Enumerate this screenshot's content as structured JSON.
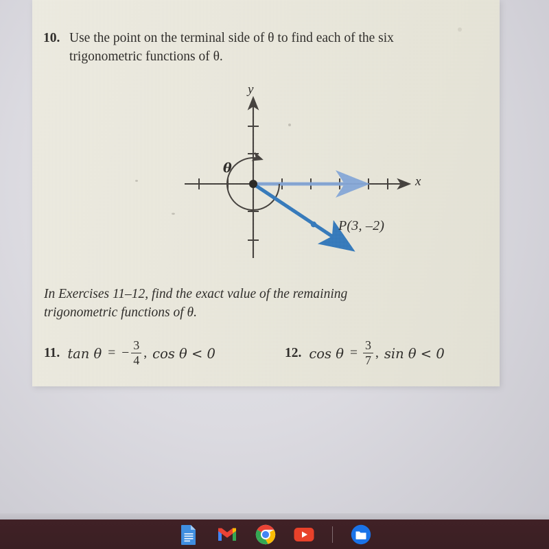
{
  "document": {
    "type": "textbook-page-photo",
    "paper_color": "#e9e7dc",
    "ink_color": "#23211e"
  },
  "problem10": {
    "number": "10.",
    "line1": "Use the point on the terminal side of θ to find each of the six",
    "line2": "trigonometric functions of θ."
  },
  "figure": {
    "y_axis_label": "y",
    "x_axis_label": "x",
    "angle_label": "θ",
    "point_label": "P(3, –2)",
    "ray_color": "#2b73b8",
    "x_ray_color": "#7fa3d6",
    "axis_color": "#3a3632"
  },
  "exercises_intro": {
    "line1": "In Exercises 11–12, find the exact value of the remaining",
    "line2": "trigonometric functions of θ."
  },
  "problem11": {
    "number": "11.",
    "func": "tan θ",
    "equals": "=",
    "minus": "−",
    "numerator": "3",
    "denominator": "4",
    "comma": ",",
    "condition": "cos θ < 0"
  },
  "problem12": {
    "number": "12.",
    "func": "cos θ",
    "equals": "=",
    "numerator": "3",
    "denominator": "7",
    "comma": ",",
    "condition": "sin θ < 0"
  },
  "taskbar": {
    "background_color": "#3d2025",
    "items": [
      {
        "name": "google-docs-icon",
        "label": "Google Docs"
      },
      {
        "name": "gmail-icon",
        "label": "Gmail"
      },
      {
        "name": "chrome-icon",
        "label": "Google Chrome"
      },
      {
        "name": "youtube-icon",
        "label": "YouTube"
      },
      {
        "name": "taskbar-separator",
        "label": ""
      },
      {
        "name": "files-icon",
        "label": "Files"
      }
    ]
  }
}
